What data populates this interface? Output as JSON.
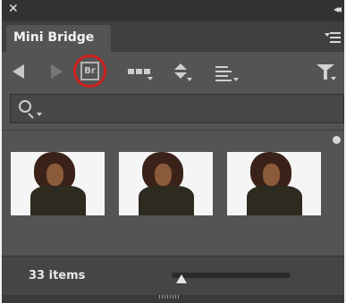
{
  "titlebar": {
    "close_icon": "close-x",
    "collapse_icon": "double-chevron-right"
  },
  "panel": {
    "tab_label": "Mini Bridge",
    "menu_icon": "panel-menu"
  },
  "toolbar": {
    "back_icon": "back-arrow",
    "forward_icon": "forward-arrow",
    "bridge_label": "Br",
    "highlight_color": "#d11f1f",
    "view_icon": "view-options",
    "sort_icon": "sort-ascending-descending",
    "tools_icon": "list-tools",
    "filter_icon": "filter-funnel"
  },
  "search": {
    "icon": "search-magnifier",
    "value": ""
  },
  "content": {
    "thumbnails": [
      {
        "alt": "portrait photo 1"
      },
      {
        "alt": "portrait photo 2"
      },
      {
        "alt": "portrait photo 3"
      }
    ]
  },
  "status": {
    "items_count": "33 items",
    "thumbnail_size": 0.08
  }
}
